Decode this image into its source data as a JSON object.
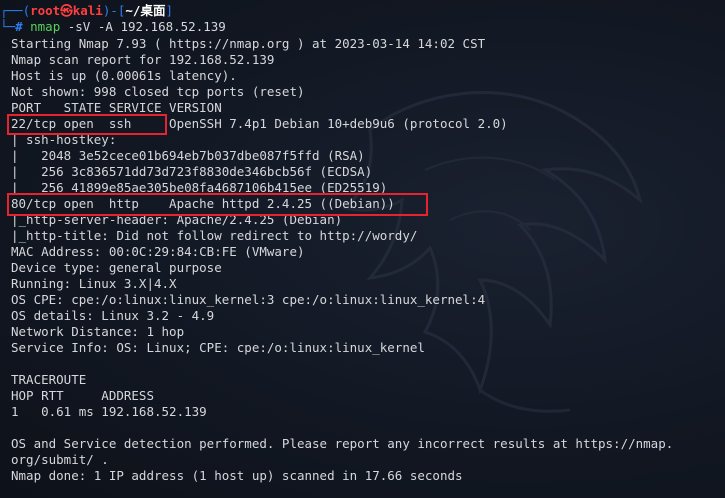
{
  "prompt": {
    "frame_open": "┌──(",
    "user_host": "root㉿kali",
    "frame_mid": ")-[",
    "cwd": "~/桌面",
    "frame_close": "]",
    "frame_bottom": "└─",
    "dollar": "#",
    "command": "nmap",
    "args": " -sV -A 192.168.52.139"
  },
  "output": [
    "Starting Nmap 7.93 ( https://nmap.org ) at 2023-03-14 14:02 CST",
    "Nmap scan report for 192.168.52.139",
    "Host is up (0.00061s latency).",
    "Not shown: 998 closed tcp ports (reset)",
    "PORT   STATE SERVICE VERSION",
    "22/tcp open  ssh     OpenSSH 7.4p1 Debian 10+deb9u6 (protocol 2.0)",
    "| ssh-hostkey:",
    "|   2048 3e52cece01b694eb7b037dbe087f5ffd (RSA)",
    "|   256 3c836571dd73d723f8830de346bcb56f (ECDSA)",
    "|_  256 41899e85ae305be08fa4687106b415ee (ED25519)",
    "80/tcp open  http    Apache httpd 2.4.25 ((Debian))",
    "|_http-server-header: Apache/2.4.25 (Debian)",
    "|_http-title: Did not follow redirect to http://wordy/",
    "MAC Address: 00:0C:29:84:CB:FE (VMware)",
    "Device type: general purpose",
    "Running: Linux 3.X|4.X",
    "OS CPE: cpe:/o:linux:linux_kernel:3 cpe:/o:linux:linux_kernel:4",
    "OS details: Linux 3.2 - 4.9",
    "Network Distance: 1 hop",
    "Service Info: OS: Linux; CPE: cpe:/o:linux:linux_kernel",
    "",
    "TRACEROUTE",
    "HOP RTT     ADDRESS",
    "1   0.61 ms 192.168.52.139",
    "",
    "OS and Service detection performed. Please report any incorrect results at https://nmap.",
    "org/submit/ .",
    "Nmap done: 1 IP address (1 host up) scanned in 17.66 seconds"
  ],
  "colors": {
    "background": "#0e121b",
    "text": "#d6d7db",
    "prompt_frame": "#2f7df0",
    "prompt_user": "#ff3f3f",
    "command": "#58d15c",
    "highlight_box": "#e8222e"
  },
  "icons": {
    "background_logo": "kali-dragon-icon"
  }
}
